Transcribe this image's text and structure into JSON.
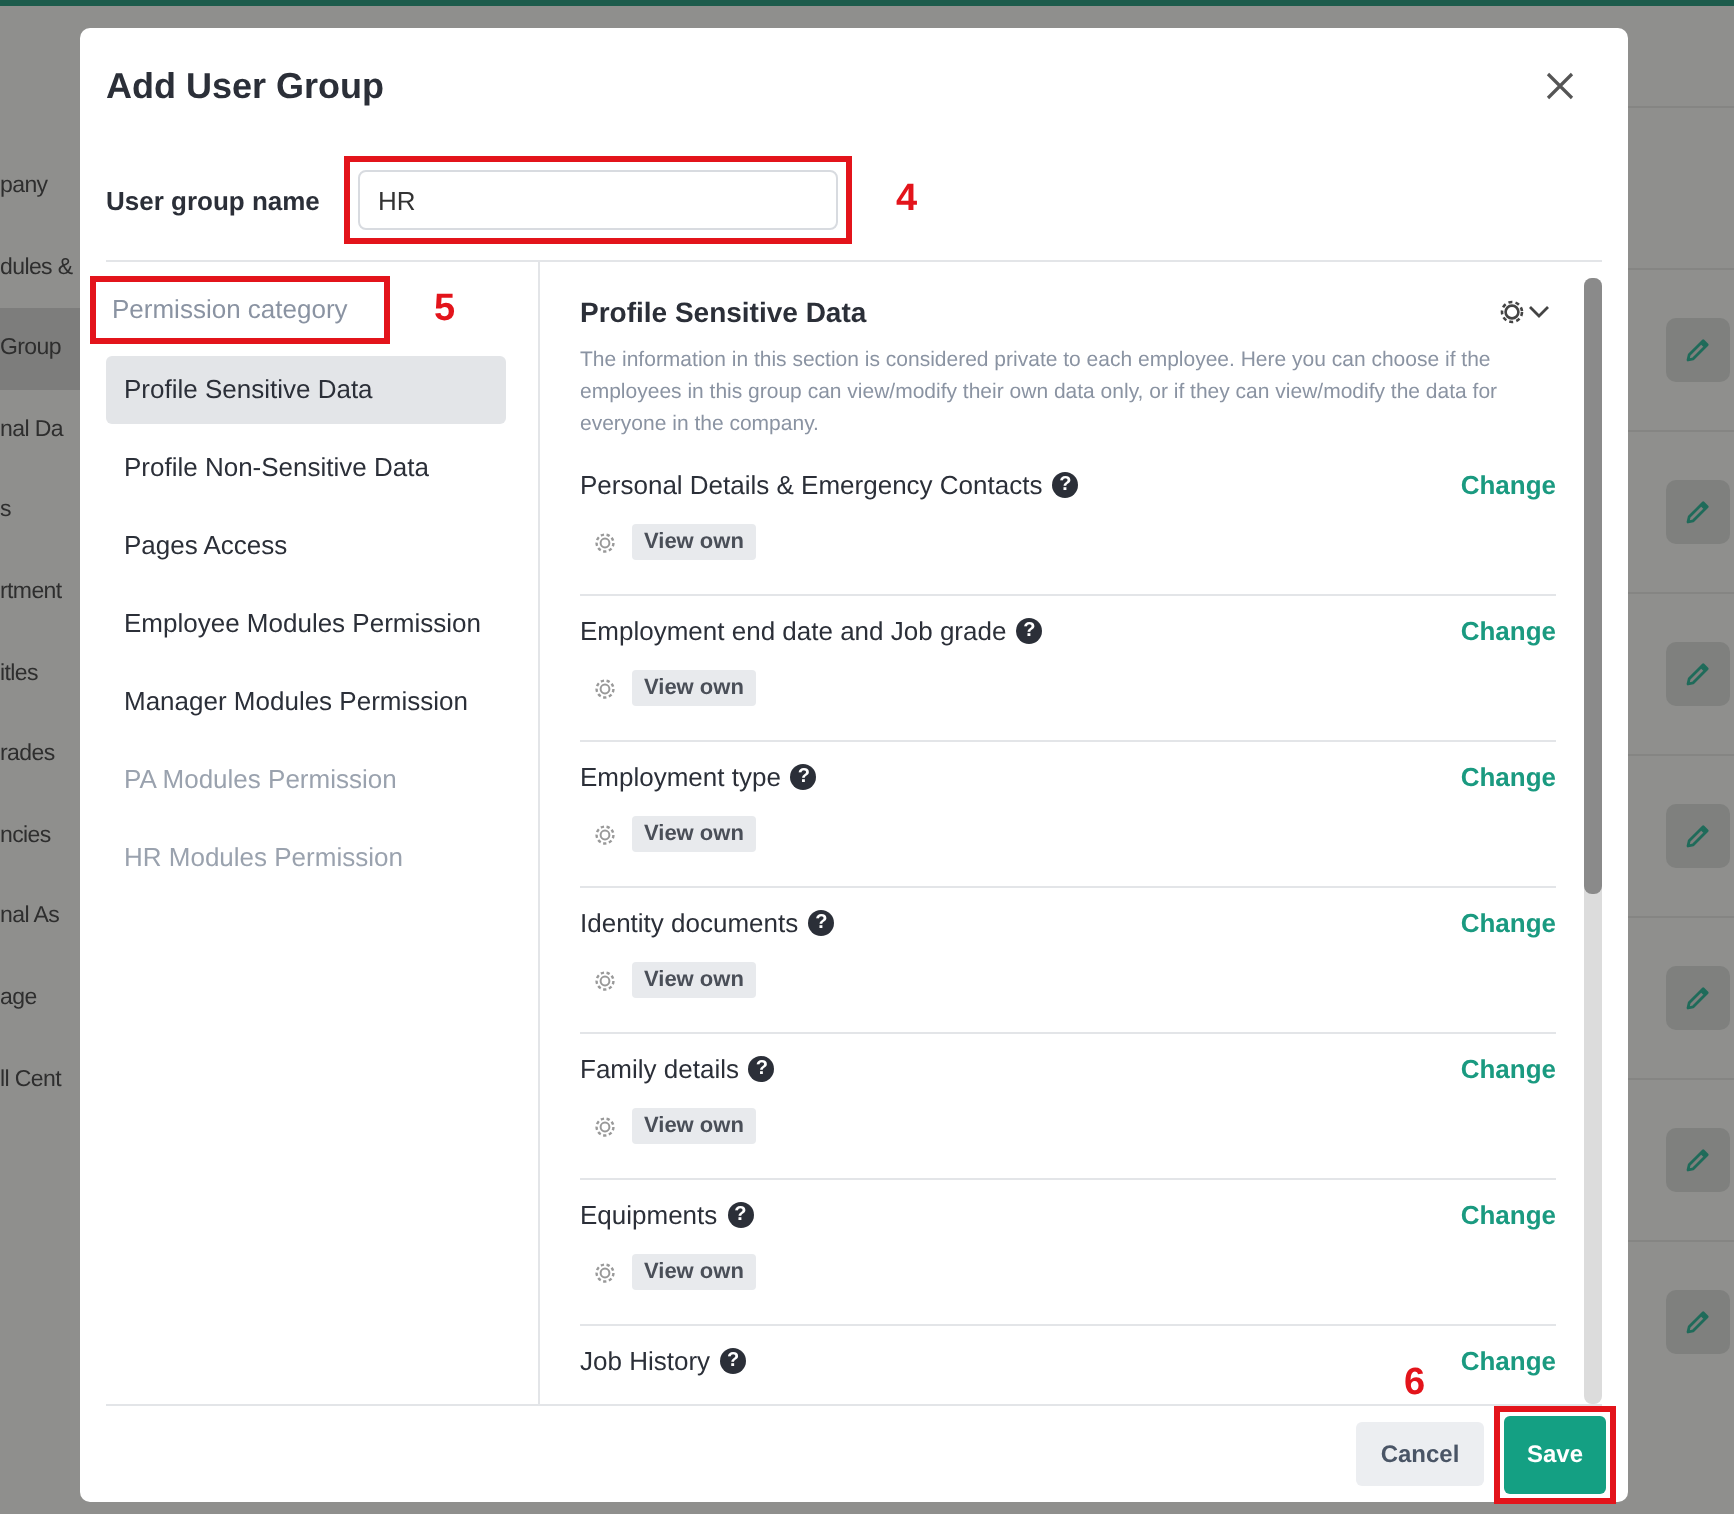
{
  "background": {
    "sidebar_items": [
      {
        "label": "pany",
        "selected": false
      },
      {
        "label": "dules &",
        "selected": false
      },
      {
        "label": "Group",
        "selected": true
      },
      {
        "label": "nal Da",
        "selected": false
      },
      {
        "label": "s",
        "selected": false
      },
      {
        "label": "rtment",
        "selected": false
      },
      {
        "label": "itles",
        "selected": false
      },
      {
        "label": "rades",
        "selected": false
      },
      {
        "label": "ncies",
        "selected": false
      },
      {
        "label": "nal As",
        "selected": false
      },
      {
        "label": "age",
        "selected": false
      },
      {
        "label": "ll Cent",
        "selected": false
      }
    ]
  },
  "dialog": {
    "title": "Add User Group",
    "name_field": {
      "label": "User group name",
      "value": "HR",
      "callout": "4"
    },
    "category": {
      "heading": "Permission category",
      "callout": "5",
      "items": [
        {
          "label": "Profile Sensitive Data",
          "selected": true,
          "disabled": false
        },
        {
          "label": "Profile Non-Sensitive Data",
          "selected": false,
          "disabled": false
        },
        {
          "label": "Pages Access",
          "selected": false,
          "disabled": false
        },
        {
          "label": "Employee Modules Permission",
          "selected": false,
          "disabled": false
        },
        {
          "label": "Manager Modules Permission",
          "selected": false,
          "disabled": false
        },
        {
          "label": "PA Modules Permission",
          "selected": false,
          "disabled": true
        },
        {
          "label": "HR Modules Permission",
          "selected": false,
          "disabled": true
        }
      ]
    },
    "section": {
      "title": "Profile Sensitive Data",
      "description": "The information in this section is considered private to each employee. Here you can choose if the employees in this group can view/modify their own data only, or if they can view/modify the data for everyone in the company.",
      "permissions": [
        {
          "title": "Personal Details & Emergency Contacts",
          "help": "?",
          "action": "Change",
          "value": "View own"
        },
        {
          "title": "Employment end date and Job grade",
          "help": "?",
          "action": "Change",
          "value": "View own"
        },
        {
          "title": "Employment type",
          "help": "?",
          "action": "Change",
          "value": "View own"
        },
        {
          "title": "Identity documents",
          "help": "?",
          "action": "Change",
          "value": "View own"
        },
        {
          "title": "Family details",
          "help": "?",
          "action": "Change",
          "value": "View own"
        },
        {
          "title": "Equipments",
          "help": "?",
          "action": "Change",
          "value": "View own"
        },
        {
          "title": "Job History",
          "help": "?",
          "action": "Change"
        }
      ]
    },
    "buttons": {
      "cancel": "Cancel",
      "save": "Save",
      "save_callout": "6"
    }
  }
}
